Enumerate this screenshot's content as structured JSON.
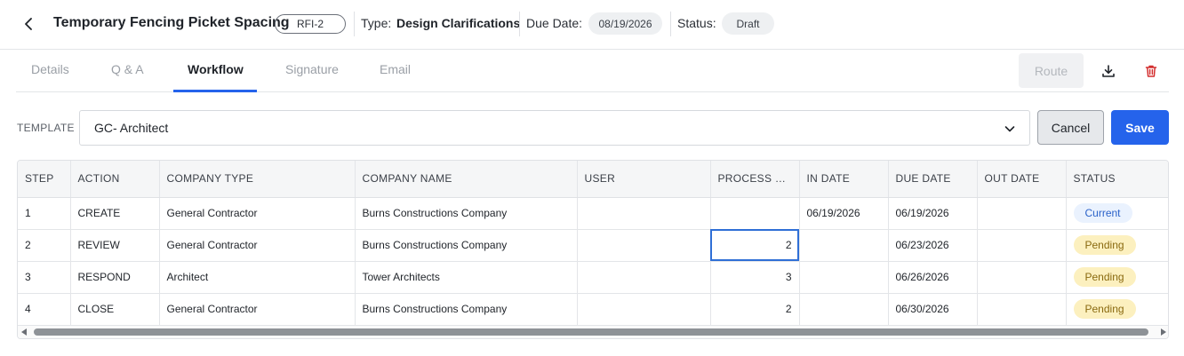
{
  "header": {
    "title": "Temporary Fencing Picket Spacing",
    "rfi": "RFI-2",
    "type_label": "Type:",
    "type_value": "Design Clarifications",
    "due_label": "Due Date:",
    "due_value": "08/19/2026",
    "status_label": "Status:",
    "status_value": "Draft"
  },
  "tabs": [
    {
      "label": "Details"
    },
    {
      "label": "Q & A"
    },
    {
      "label": "Workflow",
      "active": true
    },
    {
      "label": "Signature"
    },
    {
      "label": "Email"
    }
  ],
  "toolbar": {
    "route_label": "Route",
    "download_icon": "download-icon",
    "delete_icon": "trash-icon",
    "delete_color": "#d32f2f"
  },
  "template": {
    "label": "TEMPLATE",
    "value": "GC- Architect",
    "cancel_label": "Cancel",
    "save_label": "Save"
  },
  "table": {
    "columns": [
      "STEP",
      "ACTION",
      "COMPANY TYPE",
      "COMPANY NAME",
      "USER",
      "PROCESS D...",
      "IN DATE",
      "DUE DATE",
      "OUT DATE",
      "STATUS"
    ],
    "rows": [
      {
        "step": "1",
        "action": "CREATE",
        "company_type": "General Contractor",
        "company_name": "Burns Constructions Company",
        "user": "",
        "process_days": "",
        "in_date": "06/19/2026",
        "due_date": "06/19/2026",
        "out_date": "",
        "status": "Current"
      },
      {
        "step": "2",
        "action": "REVIEW",
        "company_type": "General Contractor",
        "company_name": "Burns Constructions Company",
        "user": "",
        "process_days": "2",
        "in_date": "",
        "due_date": "06/23/2026",
        "out_date": "",
        "status": "Pending"
      },
      {
        "step": "3",
        "action": "RESPOND",
        "company_type": "Architect",
        "company_name": "Tower Architects",
        "user": "",
        "process_days": "3",
        "in_date": "",
        "due_date": "06/26/2026",
        "out_date": "",
        "status": "Pending"
      },
      {
        "step": "4",
        "action": "CLOSE",
        "company_type": "General Contractor",
        "company_name": "Burns Constructions Company",
        "user": "",
        "process_days": "2",
        "in_date": "",
        "due_date": "06/30/2026",
        "out_date": "",
        "status": "Pending"
      }
    ]
  },
  "colors": {
    "accent": "#2563eb",
    "current_bg": "#eaf2fe",
    "pending_bg": "#fcf0bf"
  }
}
